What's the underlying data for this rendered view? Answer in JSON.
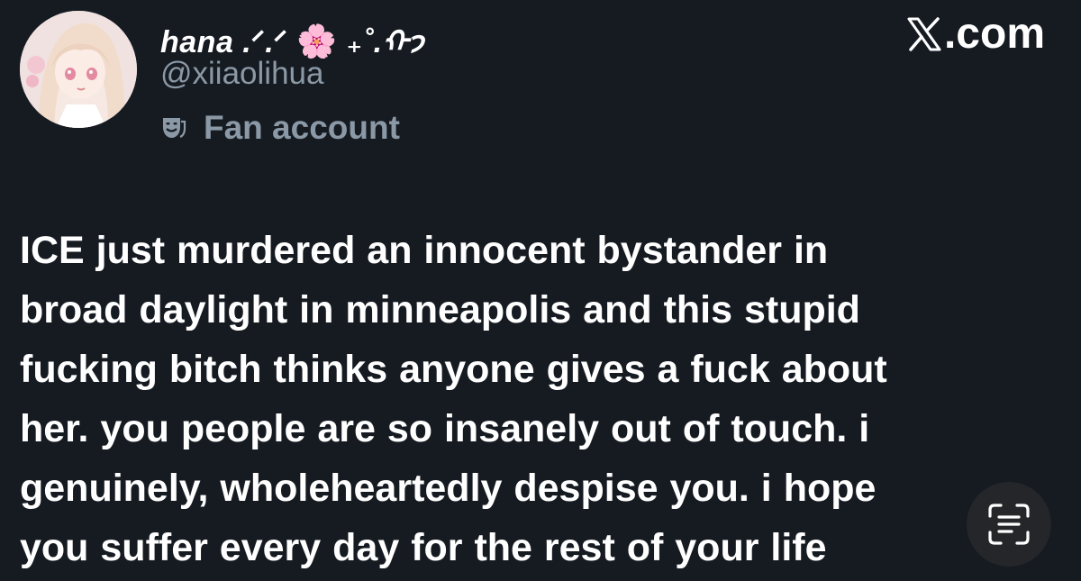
{
  "header": {
    "display_name": "hana .ᐟ.ᐟ",
    "display_name_emoji": "🌸",
    "display_name_suffix": "₊˚.ᡣ𐭩",
    "handle": "@xiiaolihua",
    "account_label": "Fan account",
    "account_label_icon": "theater-masks-icon",
    "site": ".com",
    "site_logo_icon": "x-logo-icon"
  },
  "post": {
    "lines": [
      "ICE just murdered an innocent bystander in",
      "broad daylight in minneapolis and this stupid",
      "fucking bitch thinks anyone gives a fuck about",
      "her. you people are so insanely out of touch. i",
      "genuinely, wholeheartedly despise you. i hope",
      "you suffer every day for the rest of your life"
    ]
  },
  "overlay": {
    "scan_icon": "live-text-scan-icon"
  },
  "colors": {
    "background": "#161b22",
    "primary_text": "#ffffff",
    "secondary_text": "#8b98a5"
  }
}
